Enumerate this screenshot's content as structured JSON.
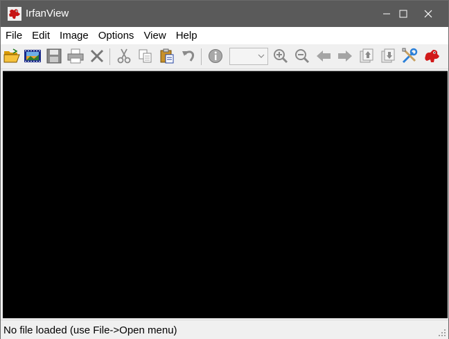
{
  "window": {
    "title": "IrfanView",
    "controls": [
      "minimize-icon",
      "maximize-icon",
      "close-icon"
    ]
  },
  "menu": {
    "items": [
      "File",
      "Edit",
      "Image",
      "Options",
      "View",
      "Help"
    ]
  },
  "toolbar": {
    "buttons": [
      {
        "name": "open-icon"
      },
      {
        "name": "slideshow-icon"
      },
      {
        "name": "save-icon"
      },
      {
        "name": "print-icon"
      },
      {
        "name": "delete-icon"
      },
      {
        "name": "cut-icon"
      },
      {
        "name": "copy-icon"
      },
      {
        "name": "paste-icon"
      },
      {
        "name": "undo-icon"
      },
      {
        "name": "info-icon"
      },
      {
        "name": "zoom-in-icon"
      },
      {
        "name": "zoom-out-icon"
      },
      {
        "name": "previous-icon"
      },
      {
        "name": "next-icon"
      },
      {
        "name": "page-up-icon"
      },
      {
        "name": "page-down-icon"
      },
      {
        "name": "settings-icon"
      },
      {
        "name": "about-icon"
      }
    ],
    "zoom_value": ""
  },
  "colors": {
    "titlebar": "#5a5a5a",
    "canvas": "#000000",
    "folder": "#f4b400",
    "tools_accent": "#2a7fd8",
    "logo_red": "#d11a1a"
  },
  "status": {
    "text": "No file loaded (use File->Open menu)"
  }
}
